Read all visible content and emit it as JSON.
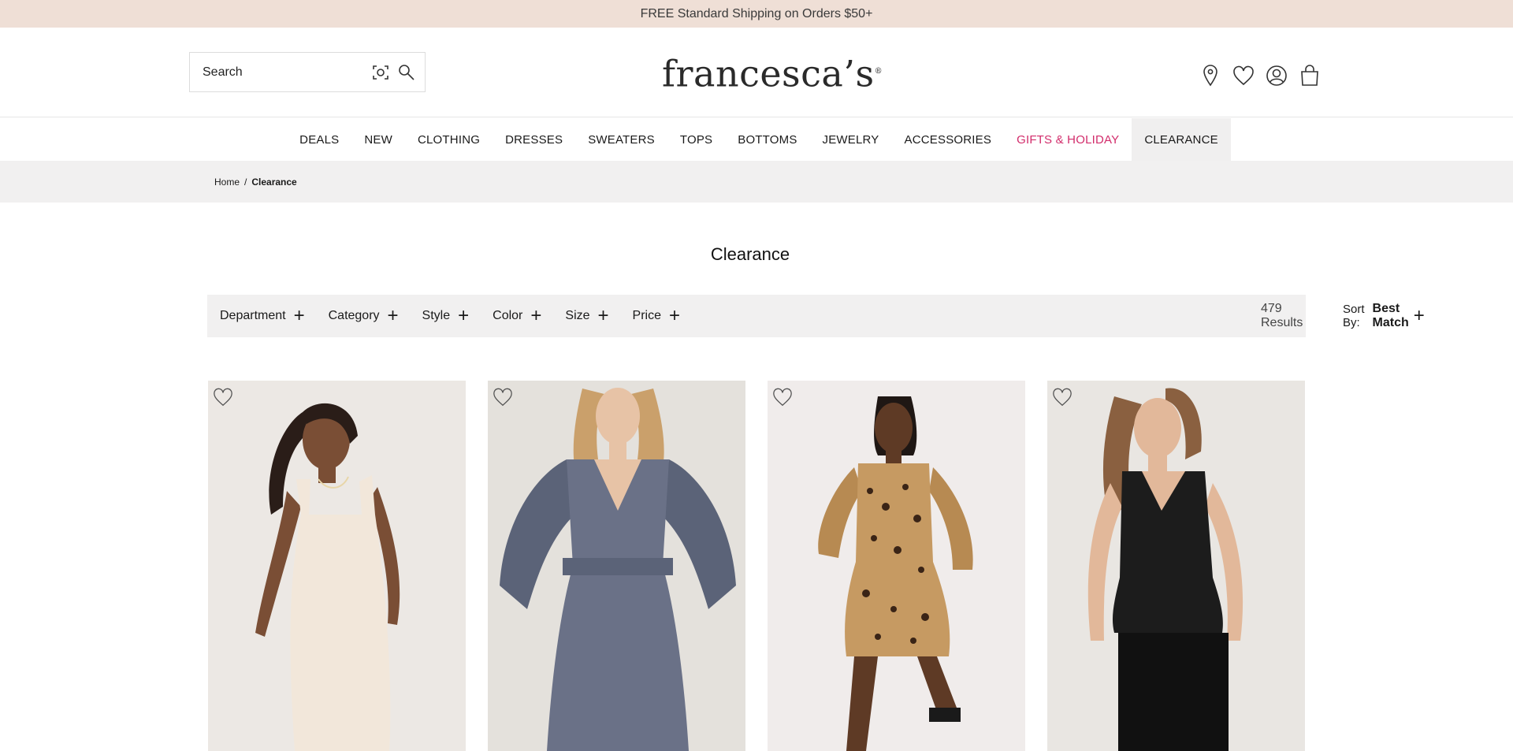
{
  "promo": {
    "text": "FREE Standard Shipping on Orders $50+"
  },
  "header": {
    "search_placeholder": "Search",
    "logo_text": "francesca’s",
    "logo_mark": "®",
    "icons": [
      "location-icon",
      "wishlist-heart-icon",
      "account-icon",
      "shopping-bag-icon"
    ]
  },
  "nav": {
    "items": [
      {
        "label": "DEALS"
      },
      {
        "label": "NEW"
      },
      {
        "label": "CLOTHING"
      },
      {
        "label": "DRESSES"
      },
      {
        "label": "SWEATERS"
      },
      {
        "label": "TOPS"
      },
      {
        "label": "BOTTOMS"
      },
      {
        "label": "JEWELRY"
      },
      {
        "label": "ACCESSORIES"
      },
      {
        "label": "GIFTS & HOLIDAY"
      },
      {
        "label": "CLEARANCE"
      }
    ],
    "active": "CLEARANCE",
    "highlight_color": "#d22c6b"
  },
  "breadcrumb": {
    "home": "Home",
    "separator": "/",
    "current": "Clearance"
  },
  "page": {
    "title": "Clearance"
  },
  "filters": {
    "items": [
      {
        "label": "Department"
      },
      {
        "label": "Category"
      },
      {
        "label": "Style"
      },
      {
        "label": "Color"
      },
      {
        "label": "Size"
      },
      {
        "label": "Price"
      }
    ],
    "expand_symbol": "+",
    "results": "479 Results",
    "sort_label": "Sort By:",
    "sort_value": "Best Match"
  },
  "products": [
    {
      "icon": "wishlist-heart-icon",
      "bg": "#ece8e4"
    },
    {
      "icon": "wishlist-heart-icon",
      "bg": "#e4e1dc"
    },
    {
      "icon": "wishlist-heart-icon",
      "bg": "#f0eceb"
    },
    {
      "icon": "wishlist-heart-icon",
      "bg": "#e9e6e2"
    }
  ],
  "colors": {
    "promo_bg": "#efdfd6",
    "bar_bg": "#f1f0f0",
    "accent_pink": "#d22c6b"
  }
}
